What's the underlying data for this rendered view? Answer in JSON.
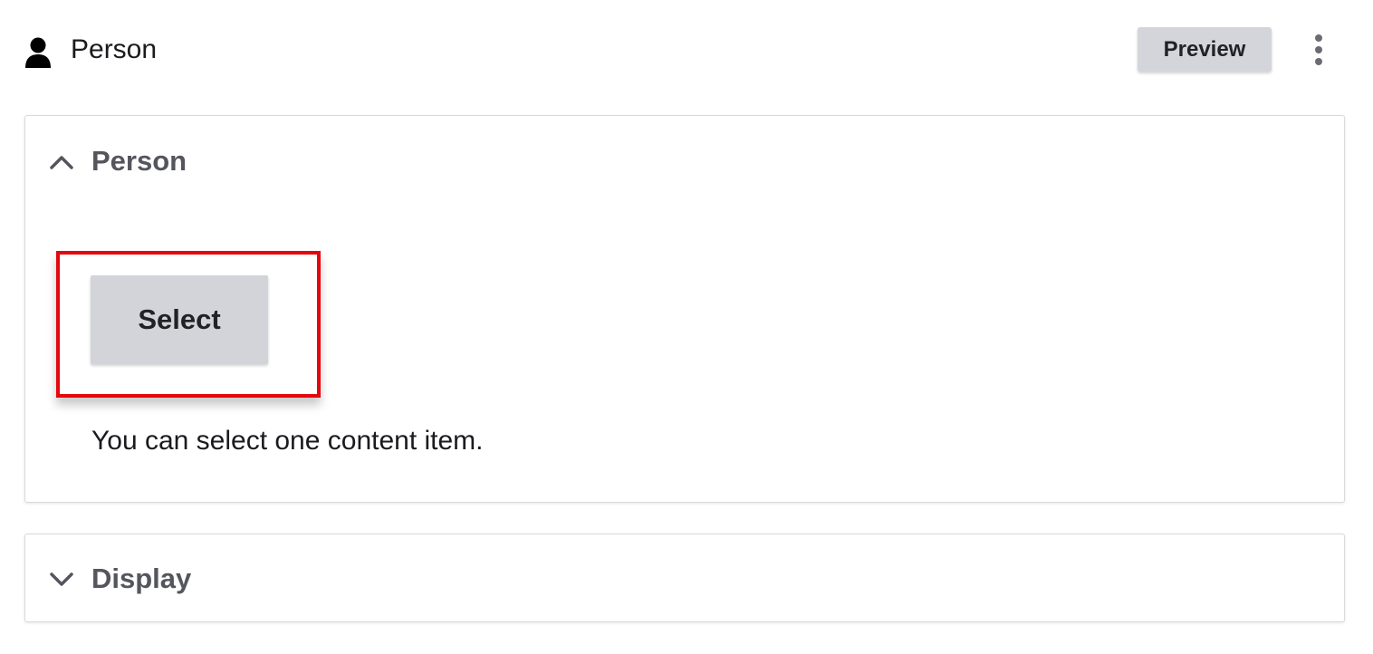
{
  "header": {
    "title": "Person",
    "icon": "person-icon",
    "preview_label": "Preview",
    "menu_icon": "kebab-menu-icon"
  },
  "panels": [
    {
      "title": "Person",
      "expanded": true,
      "chevron_icon": "chevron-up-icon",
      "select_label": "Select",
      "help_text": "You can select one content item."
    },
    {
      "title": "Display",
      "expanded": false,
      "chevron_icon": "chevron-down-icon"
    }
  ],
  "colors": {
    "highlight": "#e5070d",
    "button_bg": "#d3d4d9",
    "panel_title": "#55565d"
  }
}
